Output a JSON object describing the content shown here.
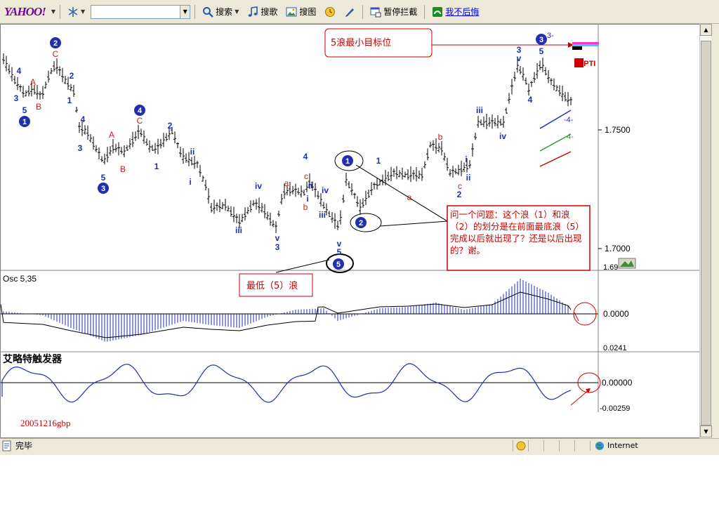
{
  "toolbar": {
    "logo": "YAHOO!",
    "search_label": "搜索",
    "music_label": "搜歌",
    "image_label": "搜图",
    "block_label": "暂停拦截",
    "link_label": "我不后悔"
  },
  "chart": {
    "price_ticks": [
      "1.7500",
      "1.7000",
      "1.69"
    ],
    "osc_title": "Osc 5,35",
    "osc_ticks": [
      "0.0000",
      "0.0241"
    ],
    "trigger_title": "艾略特触发器",
    "trigger_ticks": [
      "0.00000",
      "-0.00259"
    ],
    "footer_code": "20051216gbp",
    "pti_tag": "63PTI",
    "annotation_target": "5浪最小目标位",
    "annotation_question": "问一个问题：这个浪（1）和浪（2）的划分是在前面最底浪（5）完成以后就出现了？还是以后出现的？谢。",
    "annotation_lowest": "最低（5）浪",
    "wave_labels": {
      "c1": "1",
      "c2": "2",
      "c3": "3",
      "c4": "4",
      "c5": "5",
      "n1": "1",
      "n2": "2",
      "n3": "3",
      "n4": "4",
      "n5": "5",
      "A": "A",
      "B": "B",
      "C": "C",
      "a": "a",
      "b": "b",
      "c": "c",
      "i": "i",
      "ii": "ii",
      "iii": "iii",
      "iv": "iv",
      "v": "v",
      "m4": "-4-",
      "m3": "3-",
      "m4b": "4-"
    }
  },
  "status": {
    "text": "完毕",
    "zone": "Internet"
  },
  "colors": {
    "wave_blue": "#1f2fb0",
    "wave_red": "#d11a1a",
    "annotation_red": "#cc0000",
    "bars": "#000000"
  }
}
